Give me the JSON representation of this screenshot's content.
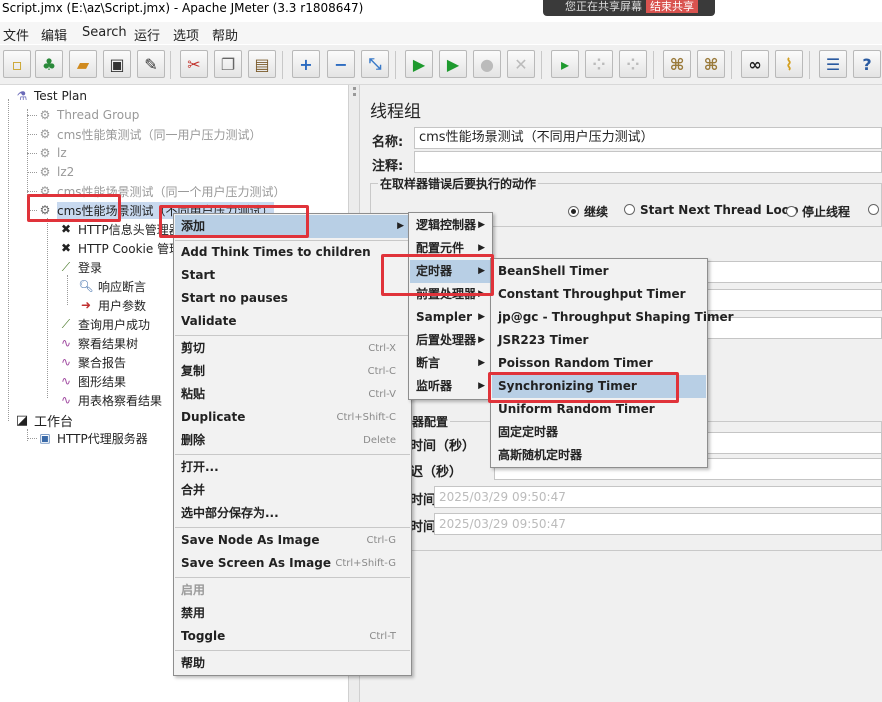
{
  "window": {
    "title": "Script.jmx (E:\\az\\Script.jmx) - Apache JMeter (3.3 r1808647)",
    "share_text": "您正在共享屏幕",
    "share_stop": "结束共享"
  },
  "menubar": [
    "文件",
    "编辑",
    "Search",
    "运行",
    "选项",
    "帮助"
  ],
  "toolbar_icons": [
    "new-icon",
    "templates-icon",
    "open-icon",
    "save-icon",
    "save-as-icon",
    "cut-icon",
    "copy-icon",
    "paste-icon",
    "expand-icon",
    "collapse-icon",
    "toggle-icon",
    "start-icon",
    "start-no-pause-icon",
    "stop-icon",
    "shutdown-icon",
    "remote-start-icon",
    "remote-stop-icon",
    "remote-shutdown-icon",
    "clear-icon",
    "clear-all-icon",
    "search-icon",
    "reset-search-icon",
    "function-helper-icon",
    "help-icon"
  ],
  "tree": {
    "test_plan": "Test Plan",
    "items": [
      "Thread Group",
      "cms性能策测试（同一用户压力测试）",
      "lz",
      "lz2",
      "cms性能场景测试（同一个用户压力测试）",
      "cms性能场景测试（不同用户压力测试）"
    ],
    "children": [
      "HTTP信息头管理器",
      "HTTP Cookie 管理器",
      "登录",
      "响应断言",
      "用户参数",
      "查询用户成功",
      "察看结果树",
      "聚合报告",
      "图形结果",
      "用表格察看结果"
    ],
    "workbench": "工作台",
    "proxy": "HTTP代理服务器"
  },
  "panel": {
    "title": "线程组",
    "name_label": "名称:",
    "name_value": "cms性能场景测试（不同用户压力测试）",
    "comment_label": "注释:",
    "error_action_title": "在取样器错误后要执行的动作",
    "actions": [
      "继续",
      "Start Next Thread Loop",
      "停止线程"
    ],
    "selected_action": "继续",
    "sched_title": "器配置",
    "duration_label": "时间（秒）",
    "delay_label": "迟（秒）",
    "start_label": "时间",
    "end_label": "时间",
    "start_time": "2025/03/29 09:50:47",
    "end_time": "2025/03/29 09:50:47"
  },
  "context_menu": {
    "add": "添加",
    "add_think": "Add Think Times to children",
    "start": "Start",
    "start_no_pauses": "Start no pauses",
    "validate": "Validate",
    "cut": "剪切",
    "cut_key": "Ctrl-X",
    "copy": "复制",
    "copy_key": "Ctrl-C",
    "paste": "粘贴",
    "paste_key": "Ctrl-V",
    "duplicate": "Duplicate",
    "duplicate_key": "Ctrl+Shift-C",
    "delete": "删除",
    "delete_key": "Delete",
    "open": "打开...",
    "merge": "合并",
    "save_selection": "选中部分保存为...",
    "save_node_image": "Save Node As Image",
    "save_node_key": "Ctrl-G",
    "save_screen_image": "Save Screen As Image",
    "save_screen_key": "Ctrl+Shift-G",
    "enable": "启用",
    "disable": "禁用",
    "toggle": "Toggle",
    "toggle_key": "Ctrl-T",
    "help": "帮助"
  },
  "add_submenu": [
    "逻辑控制器",
    "配置元件",
    "定时器",
    "前置处理器",
    "Sampler",
    "后置处理器",
    "断言",
    "监听器"
  ],
  "timer_submenu": [
    "BeanShell Timer",
    "Constant Throughput Timer",
    "jp@gc - Throughput Shaping Timer",
    "JSR223 Timer",
    "Poisson Random Timer",
    "Synchronizing Timer",
    "Uniform Random Timer",
    "固定定时器",
    "高斯随机定时器"
  ],
  "colors": {
    "highlight": "#b8cfe5",
    "annotation": "#e0333a",
    "selection": "#c8d9ef"
  }
}
